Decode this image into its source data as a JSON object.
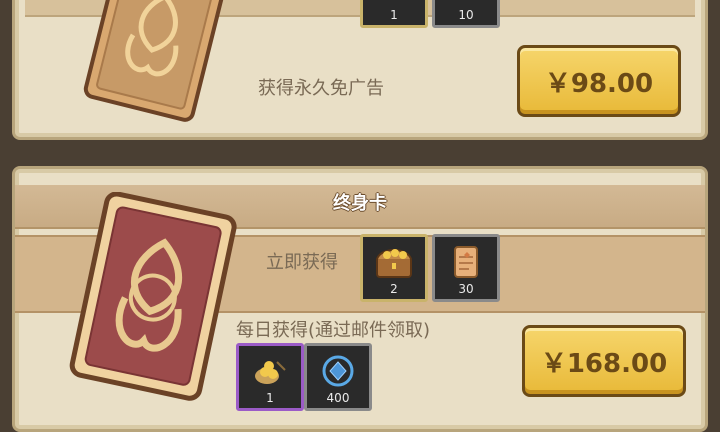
{
  "panel_top": {
    "rewards": [
      {
        "icon": "item-icon",
        "count": "1"
      },
      {
        "icon": "item-icon",
        "count": "10"
      }
    ],
    "benefit_text": "获得永久免广告",
    "price": "￥98.00"
  },
  "panel_bottom": {
    "title": "终身卡",
    "immediate_label": "立即获得",
    "immediate_rewards": [
      {
        "icon": "treasure-chest-icon",
        "count": "2"
      },
      {
        "icon": "scroll-icon",
        "count": "30"
      }
    ],
    "daily_label": "每日获得(通过邮件领取)",
    "daily_rewards": [
      {
        "icon": "gold-nuggets-icon",
        "count": "1"
      },
      {
        "icon": "blue-gem-icon",
        "count": "400"
      }
    ],
    "price": "￥168.00"
  },
  "colors": {
    "panel_bg": "#e9dfc6",
    "band": "#d3b58c",
    "price_button": "#f0c94a",
    "price_text": "#6b4a16",
    "slot_bg": "#2a2a2a"
  }
}
